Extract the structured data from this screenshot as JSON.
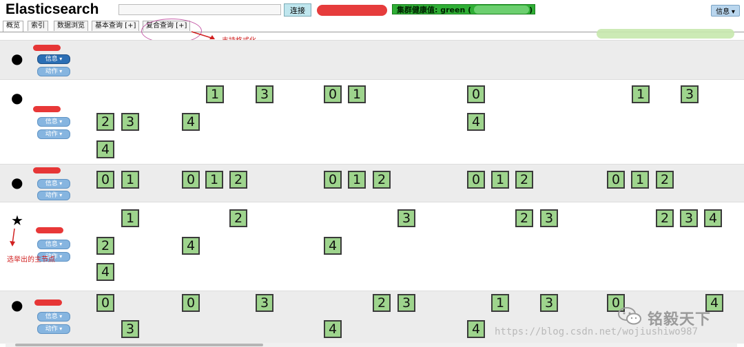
{
  "header": {
    "title": "Elasticsearch",
    "connect_label": "连接",
    "health_label": "集群健康值: green (",
    "health_close": ")",
    "info_label": "信息"
  },
  "tabs": [
    {
      "label": "概览",
      "active": true
    },
    {
      "label": "索引",
      "active": false
    },
    {
      "label": "数据浏览",
      "active": false
    },
    {
      "label": "基本查询 [+]",
      "active": false
    },
    {
      "label": "复合查询 [+]",
      "active": false
    }
  ],
  "annotations": {
    "format_note": "支持格式化",
    "master_note": "选举出的主节点"
  },
  "node_buttons": {
    "info": "信息",
    "action": "动作"
  },
  "nodes": [
    {
      "marker": "●",
      "type": "dot"
    },
    {
      "marker": "●",
      "type": "dot"
    },
    {
      "marker": "●",
      "type": "dot"
    },
    {
      "marker": "★",
      "type": "master"
    },
    {
      "marker": "●",
      "type": "dot"
    }
  ],
  "shards": {
    "row1": [
      "1",
      "3",
      "0",
      "1",
      "0",
      "1",
      "3",
      "2",
      "3",
      "4",
      "4",
      "4"
    ],
    "row2": [
      "0",
      "1",
      "0",
      "1",
      "2",
      "0",
      "1",
      "2",
      "0",
      "1",
      "2",
      "0",
      "1",
      "2"
    ],
    "row3": [
      "1",
      "2",
      "3",
      "2",
      "3",
      "2",
      "3",
      "4",
      "2",
      "4",
      "4",
      "4"
    ],
    "row4": [
      "0",
      "0",
      "3",
      "2",
      "3",
      "1",
      "3",
      "0",
      "4",
      "3",
      "4",
      "4"
    ]
  },
  "watermark": {
    "url": "https://blog.csdn.net/wojiushiwo987",
    "brand": "铭毅天下"
  },
  "colors": {
    "shard_fill": "#9ed48d",
    "health_green": "#2fae35",
    "annotation_red": "#d12020"
  }
}
